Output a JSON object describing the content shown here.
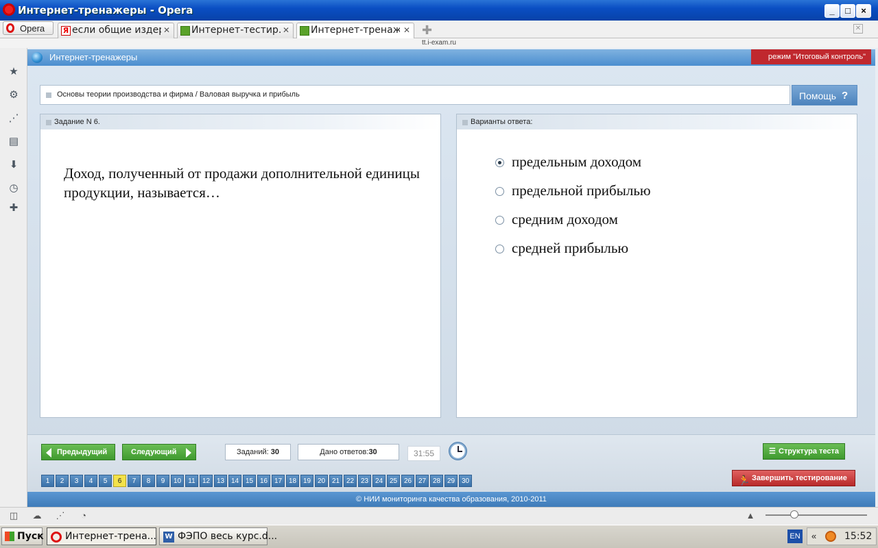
{
  "window": {
    "title": "Интернет-тренажеры - Opera",
    "controls": [
      "_",
      "□",
      "×"
    ]
  },
  "browser": {
    "menu_label": "Opera",
    "tabs": [
      {
        "label": "если общие издер...",
        "icon": "yandex-icon",
        "active": false
      },
      {
        "label": "Интернет-тестир...",
        "icon": "green-site-icon",
        "active": false
      },
      {
        "label": "Интернет-тренаж...",
        "icon": "green-site-icon",
        "active": true
      }
    ],
    "url": "tt.i-exam.ru"
  },
  "app": {
    "title": "Интернет-тренажеры",
    "mode": "режим \"Итоговый контроль\"",
    "breadcrumb": "Основы теории производства и фирма / Валовая выручка и прибыль",
    "help_label": "Помощь",
    "help_icon": "?",
    "task_panel_title": "Задание N 6.",
    "answers_panel_title": "Варианты ответа:",
    "question": "Доход, полученный от продажи дополнительной единицы продукции, называется…",
    "options": [
      {
        "text": "предельным доходом",
        "selected": true
      },
      {
        "text": "предельной прибылью",
        "selected": false
      },
      {
        "text": "средним доходом",
        "selected": false
      },
      {
        "text": "средней прибылью",
        "selected": false
      }
    ],
    "nav": {
      "prev_label": "Предыдущий",
      "next_label": "Следующий",
      "tasks_label": "Заданий:",
      "tasks_count": "30",
      "answered_label": "Дано ответов:",
      "answered_count": "30",
      "timer": "31:55",
      "structure_label": "Структура теста",
      "finish_label": "Завершить тестирование"
    },
    "pages": [
      "1",
      "2",
      "3",
      "4",
      "5",
      "6",
      "7",
      "8",
      "9",
      "10",
      "11",
      "12",
      "13",
      "14",
      "15",
      "16",
      "17",
      "18",
      "19",
      "20",
      "21",
      "22",
      "23",
      "24",
      "25",
      "26",
      "27",
      "28",
      "29",
      "30"
    ],
    "current_page": "6",
    "footer": "© НИИ мониторинга качества образования, 2010-2011"
  },
  "taskbar": {
    "start_label": "Пуск",
    "items": [
      {
        "label": "Интернет-трена...",
        "active": true
      },
      {
        "label": "ФЭПО весь курс.d...",
        "active": false
      }
    ],
    "lang": "EN",
    "tray_arrows": "«",
    "clock": "15:52"
  },
  "colors": {
    "header_blue": "#4b8ecf",
    "mode_red": "#c0282e",
    "green_button": "#3f9a2f",
    "current_page": "#f3e24a"
  }
}
